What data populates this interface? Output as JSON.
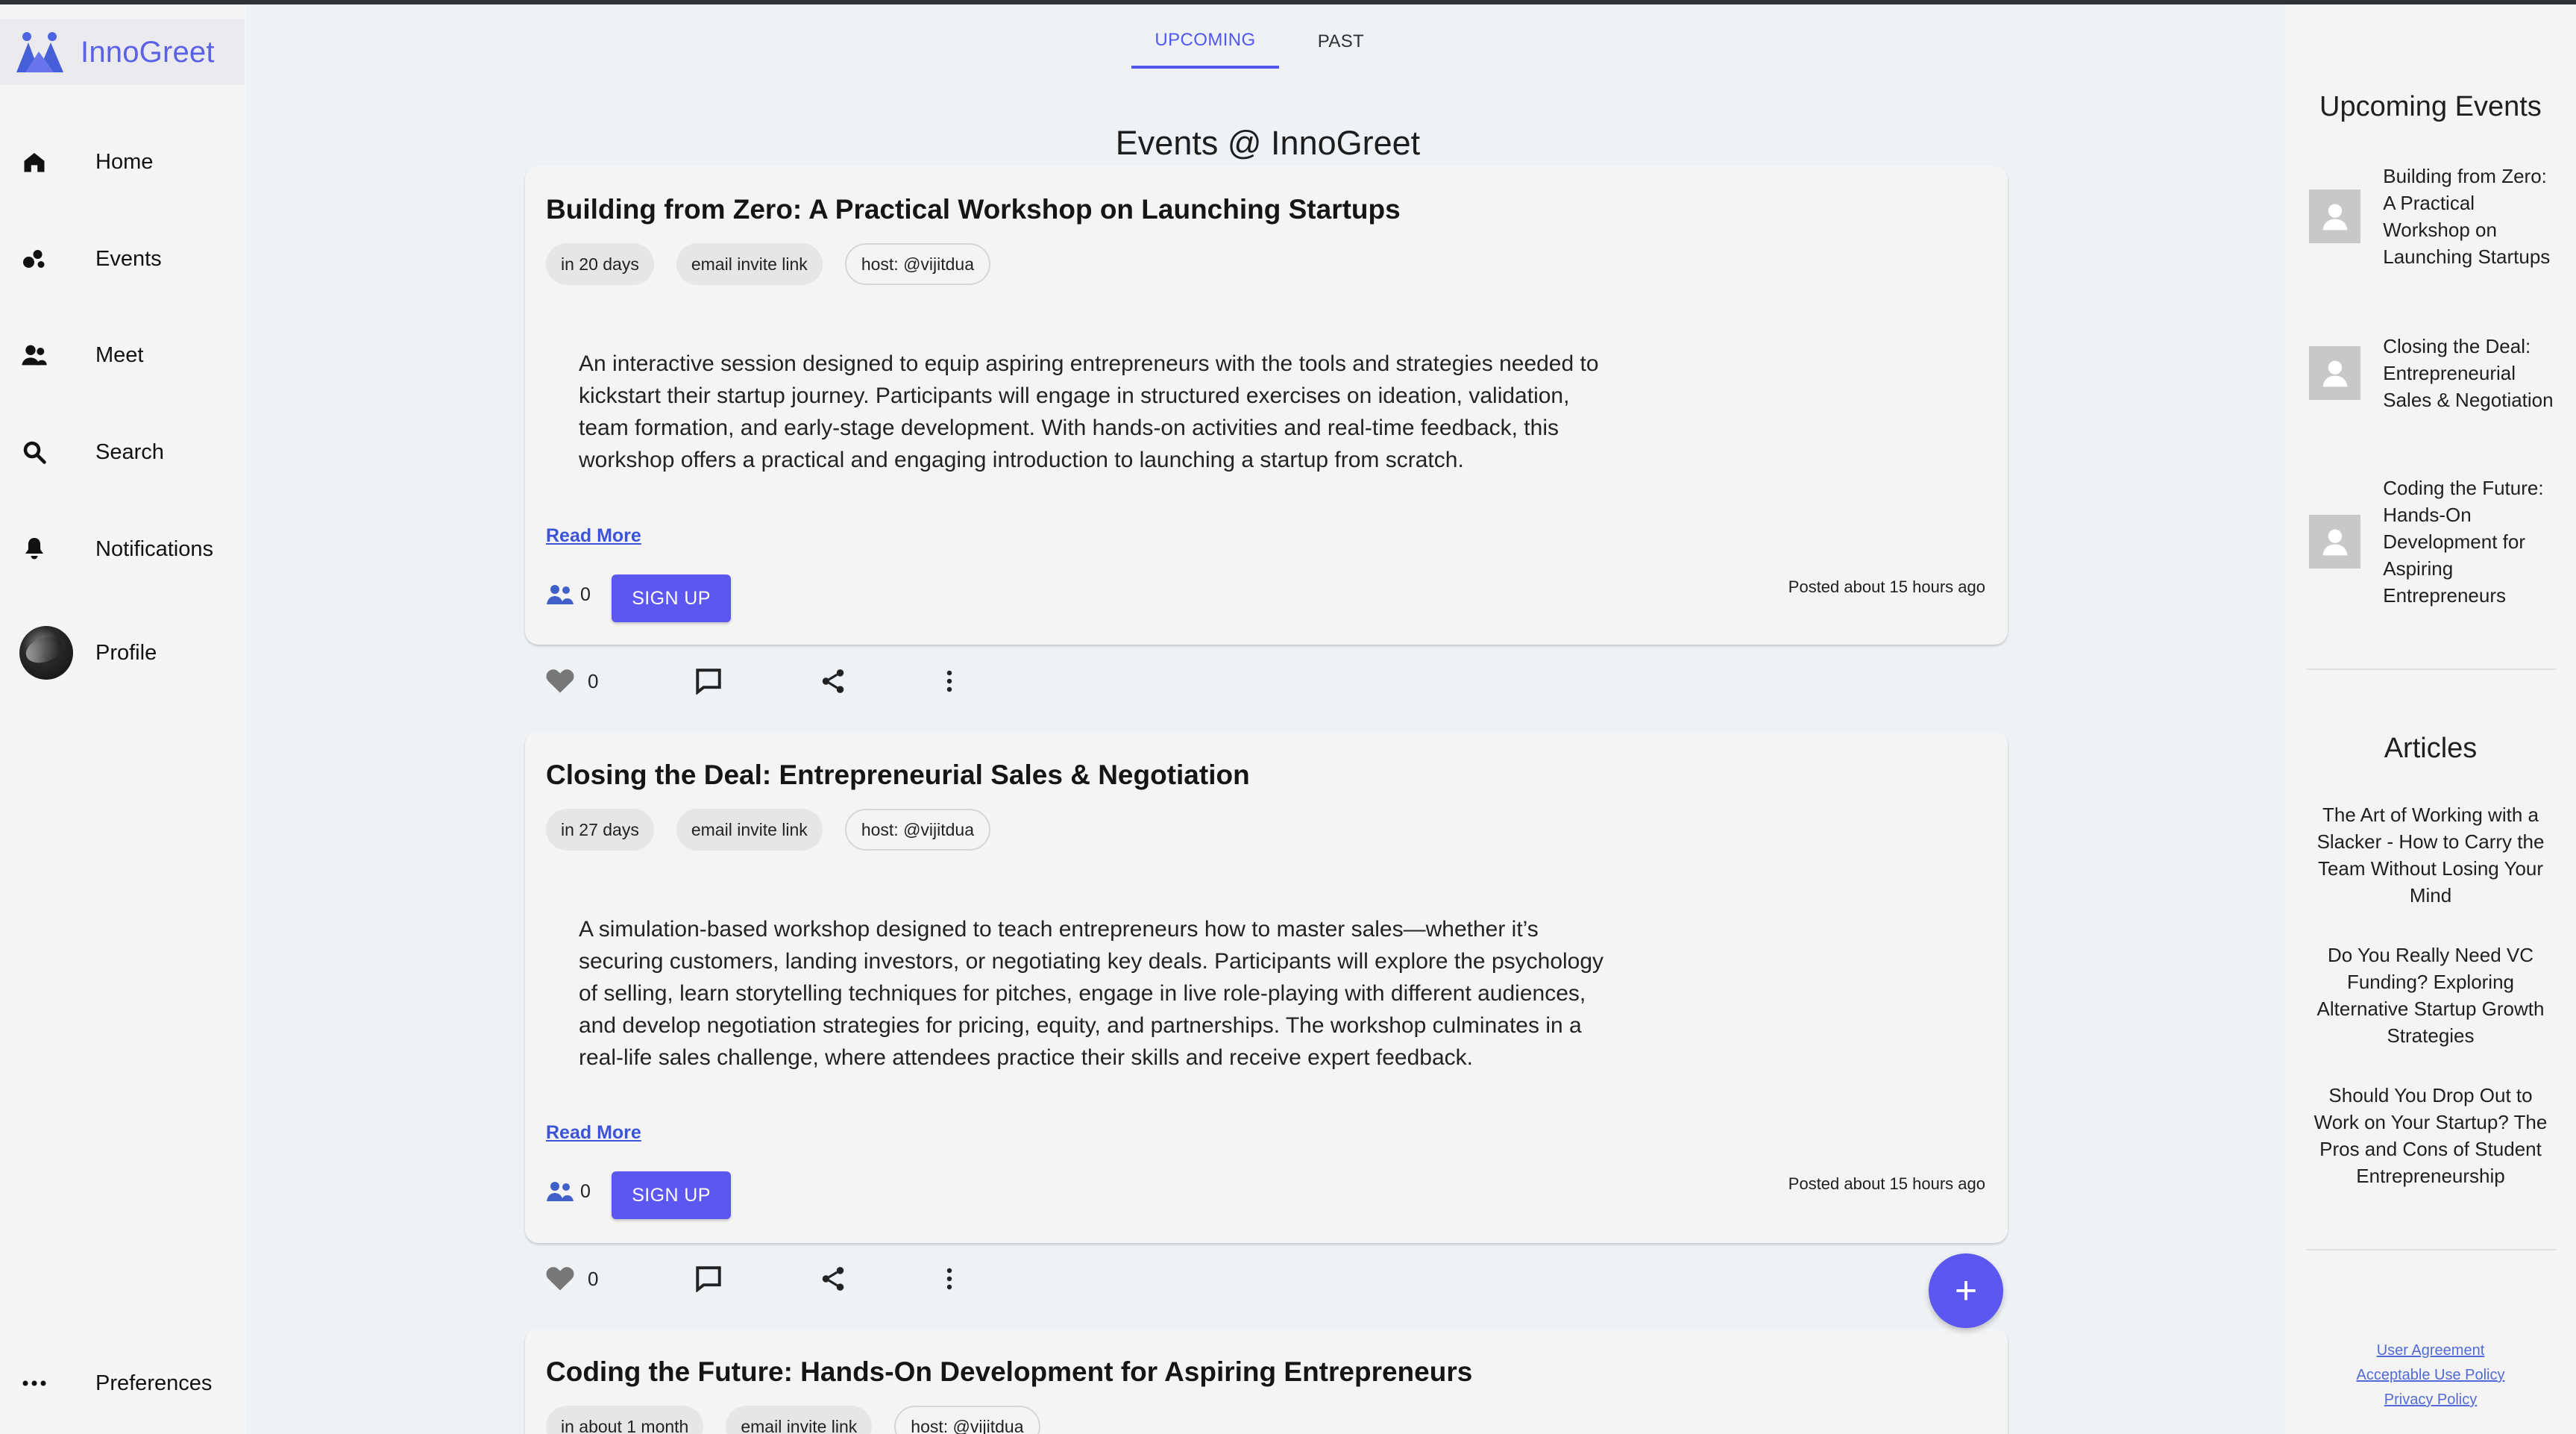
{
  "app": {
    "logo_text": "InnoGreet"
  },
  "sidebar": {
    "items": [
      {
        "label": "Home"
      },
      {
        "label": "Events"
      },
      {
        "label": "Meet"
      },
      {
        "label": "Search"
      },
      {
        "label": "Notifications"
      },
      {
        "label": "Profile"
      },
      {
        "label": "Preferences"
      }
    ]
  },
  "tabs": [
    {
      "label": "UPCOMING"
    },
    {
      "label": "PAST"
    }
  ],
  "main": {
    "title": "Events @ InnoGreet"
  },
  "events": [
    {
      "title": "Building from Zero: A Practical Workshop on Launching Startups",
      "chips": [
        "in 20 days",
        "email invite link",
        "host: @vijitdua"
      ],
      "description": "An interactive session designed to equip aspiring entrepreneurs with the tools and strategies needed to kickstart their startup journey. Participants will engage in structured exercises on ideation, validation, team formation, and early-stage development. With hands-on activities and real-time feedback, this workshop offers a practical and engaging introduction to launching a startup from scratch.",
      "read_more": "Read More",
      "attendees": "0",
      "signup": "SIGN UP",
      "posted": "Posted about 15 hours ago",
      "likes": "0"
    },
    {
      "title": "Closing the Deal: Entrepreneurial Sales & Negotiation",
      "chips": [
        "in 27 days",
        "email invite link",
        "host: @vijitdua"
      ],
      "description": "A simulation-based workshop designed to teach entrepreneurs how to master sales—whether it’s securing customers, landing investors, or negotiating key deals. Participants will explore the psychology of selling, learn storytelling techniques for pitches, engage in live role-playing with different audiences, and develop negotiation strategies for pricing, equity, and partnerships. The workshop culminates in a real-life sales challenge, where attendees practice their skills and receive expert feedback.",
      "read_more": "Read More",
      "attendees": "0",
      "signup": "SIGN UP",
      "posted": "Posted about 15 hours ago",
      "likes": "0"
    },
    {
      "title": "Coding the Future: Hands-On Development for Aspiring Entrepreneurs",
      "chips": [
        "in about 1 month",
        "email invite link",
        "host: @vijitdua"
      ]
    }
  ],
  "right": {
    "upcoming_title": "Upcoming Events",
    "upcoming": [
      "Building from Zero: A Practical Workshop on Launching Startups",
      "Closing the Deal: Entrepreneurial Sales & Negotiation",
      "Coding the Future: Hands-On Development for Aspiring Entrepreneurs"
    ],
    "articles_title": "Articles",
    "articles": [
      "The Art of Working with a Slacker - How to Carry the Team Without Losing Your Mind",
      "Do You Really Need VC Funding? Exploring Alternative Startup Growth Strategies",
      "Should You Drop Out to Work on Your Startup? The Pros and Cons of Student Entrepreneurship"
    ],
    "footer": {
      "user_agreement": "User Agreement",
      "acceptable_use": "Acceptable Use Policy",
      "privacy": "Privacy Policy"
    }
  },
  "fab": {
    "label": "+"
  },
  "colors": {
    "primary": "#5356ef",
    "link": "#3c55d8",
    "background": "#eef2f4"
  },
  "icons": {
    "home": "home-icon",
    "events": "events-icon",
    "meet": "people-icon",
    "search": "search-icon",
    "notifications": "bell-icon",
    "preferences": "more-horizontal-icon",
    "heart": "heart-icon",
    "comment": "comment-icon",
    "share": "share-icon",
    "more": "more-vertical-icon",
    "avatar": "avatar-placeholder-icon"
  }
}
